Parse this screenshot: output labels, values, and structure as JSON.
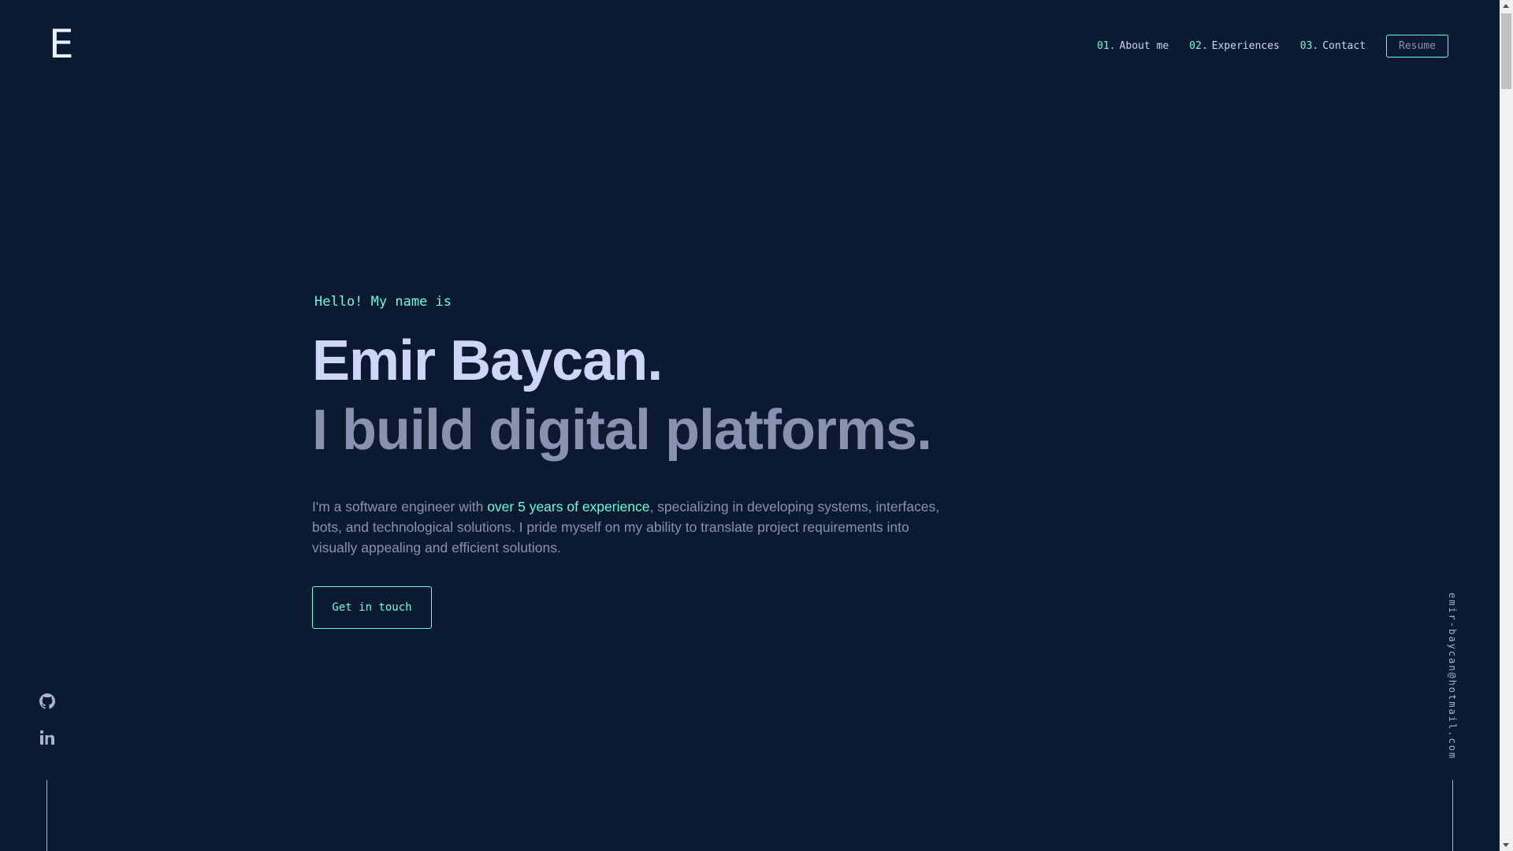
{
  "header": {
    "logo": "E",
    "nav": [
      {
        "num": "01.",
        "label": "About me"
      },
      {
        "num": "02.",
        "label": "Experiences"
      },
      {
        "num": "03.",
        "label": "Contact"
      }
    ],
    "resume_label": "Resume"
  },
  "hero": {
    "greeting": "Hello! My name is",
    "name": "Emir Baycan.",
    "tagline": "I build digital platforms.",
    "intro_before": "I'm a software engineer with ",
    "intro_highlight": "over 5 years of experience",
    "intro_after": ", specializing in developing systems, interfaces, bots, and technological solutions. I pride myself on my ability to translate project requirements into visually appealing and efficient solutions.",
    "cta_label": "Get in touch"
  },
  "socials": [
    {
      "icon": "github-icon"
    },
    {
      "icon": "linkedin-icon"
    }
  ],
  "email": "emir-baycan@hotmail.com",
  "colors": {
    "background": "#0b1a30",
    "accent": "#64ffda",
    "text_light": "#ccd6f6",
    "text_muted": "#8892b0"
  }
}
